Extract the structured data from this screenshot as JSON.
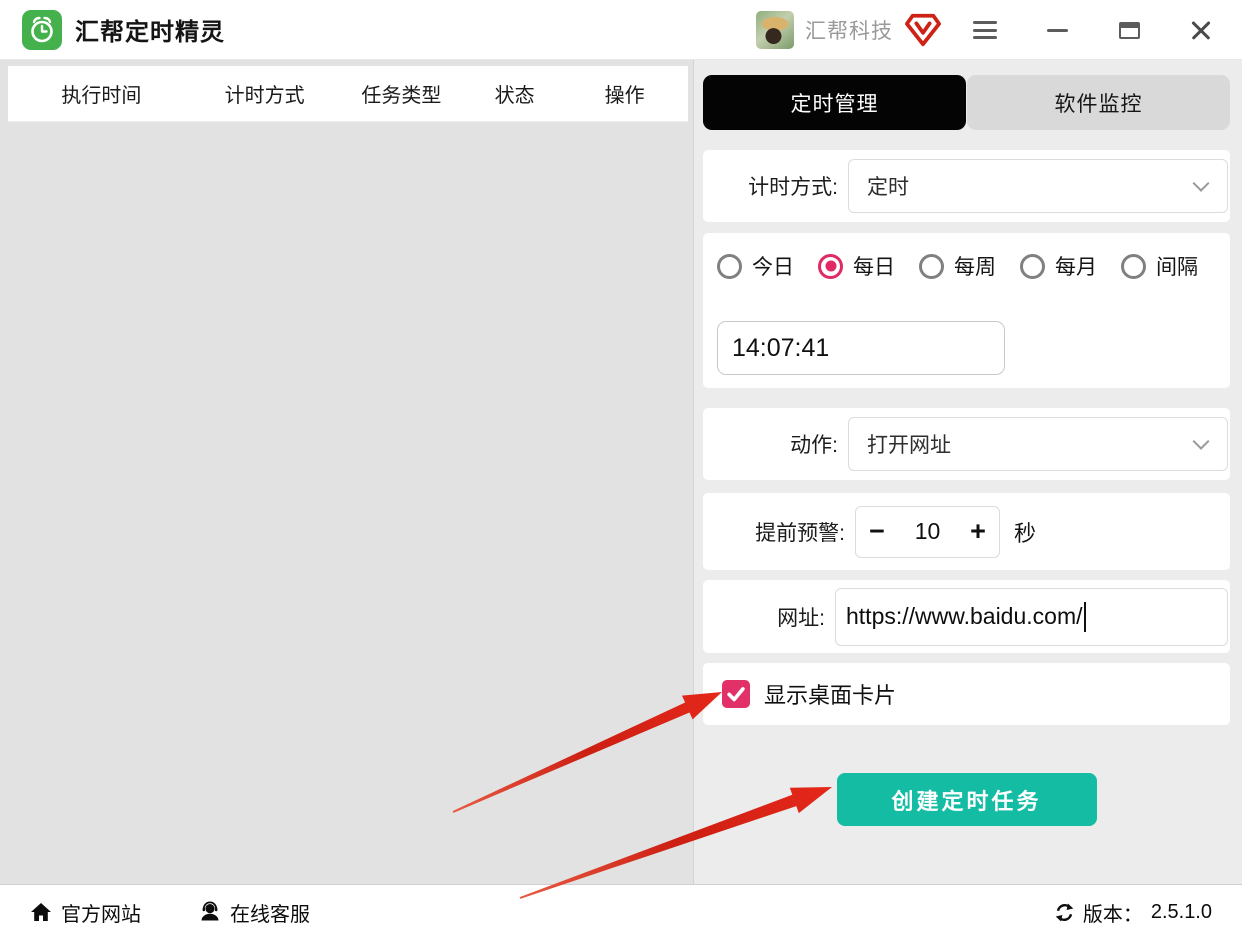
{
  "window": {
    "title": "汇帮定时精灵",
    "brand": "汇帮科技"
  },
  "task_table": {
    "columns": [
      "执行时间",
      "计时方式",
      "任务类型",
      "状态",
      "操作"
    ],
    "rows": []
  },
  "tabs": [
    {
      "label": "定时管理",
      "active": true
    },
    {
      "label": "软件监控",
      "active": false
    }
  ],
  "form": {
    "timing_method": {
      "label": "计时方式:",
      "value": "定时"
    },
    "schedule_options": [
      {
        "label": "今日",
        "selected": false
      },
      {
        "label": "每日",
        "selected": true
      },
      {
        "label": "每周",
        "selected": false
      },
      {
        "label": "每月",
        "selected": false
      },
      {
        "label": "间隔",
        "selected": false
      }
    ],
    "time_value": "14:07:41",
    "action": {
      "label": "动作:",
      "value": "打开网址"
    },
    "warning": {
      "label": "提前预警:",
      "minus": "−",
      "value": "10",
      "plus": "+",
      "unit": "秒"
    },
    "url": {
      "label": "网址:",
      "value": "https://www.baidu.com/"
    },
    "desktop_card": {
      "label": "显示桌面卡片",
      "checked": true
    },
    "submit_label": "创建定时任务"
  },
  "footer": {
    "official_site": "官方网站",
    "online_support": "在线客服",
    "version_label": "版本：",
    "version": "2.5.1.0"
  },
  "icons": {
    "app": "alarm-clock",
    "badge": "vip-diamond",
    "menu": "hamburger",
    "minimize": "minimize",
    "maximize": "maximize",
    "close": "close",
    "chevron": "chevron-down",
    "home": "home",
    "support": "headset-person",
    "refresh": "sync"
  },
  "colors": {
    "accent_pink": "#e02a63",
    "button_teal": "#14bca4",
    "tab_active_bg": "#040404",
    "arrow_red": "#d7261a",
    "app_green": "#45b14c"
  }
}
